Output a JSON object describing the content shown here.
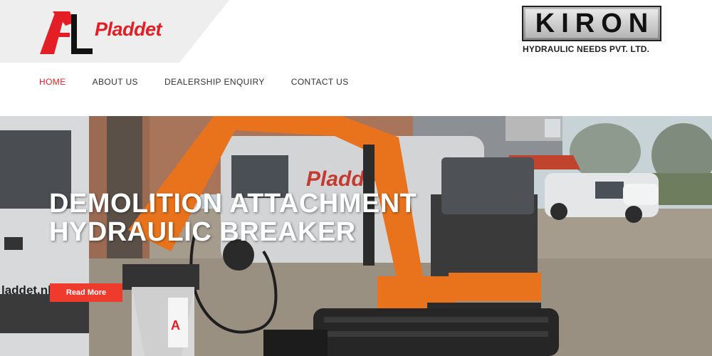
{
  "brand": {
    "logo_text": "Pladdet",
    "kiron_name": "KIRON",
    "kiron_subtitle": "HYDRAULIC NEEDS PVT. LTD."
  },
  "nav": {
    "items": [
      {
        "label": "HOME",
        "active": true
      },
      {
        "label": "ABOUT US",
        "active": false
      },
      {
        "label": "DEALERSHIP ENQUIRY",
        "active": false
      },
      {
        "label": "CONTACT US",
        "active": false
      }
    ]
  },
  "hero": {
    "title_line1": "DEMOLITION ATTACHMENT",
    "title_line2": "HYDRAULIC BREAKER",
    "button_label": "Read More",
    "van_text": "Pladdet",
    "left_van_text": "laddet.nl"
  },
  "colors": {
    "accent": "#e31e24",
    "button": "#ee3b2e",
    "excavator_orange": "#e8731c"
  }
}
